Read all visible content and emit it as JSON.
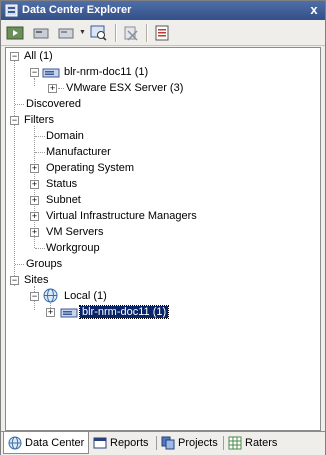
{
  "window": {
    "title": "Data Center Explorer",
    "close_label": "x"
  },
  "toolbar": {
    "buttons": [
      {
        "name": "connect-icon"
      },
      {
        "name": "add-device-icon"
      },
      {
        "name": "device-dropdown-icon"
      },
      {
        "name": "find-icon"
      },
      {
        "name": "delete-icon"
      },
      {
        "name": "properties-icon"
      }
    ]
  },
  "tree": {
    "all": "All (1)",
    "host": "blr-nrm-doc11 (1)",
    "vmware": "VMware ESX Server (3)",
    "discovered": "Discovered",
    "filters": "Filters",
    "filter_items": {
      "domain": "Domain",
      "manufacturer": "Manufacturer",
      "operating_system": "Operating System",
      "status": "Status",
      "subnet": "Subnet",
      "vim": "Virtual Infrastructure Managers",
      "vm_servers": "VM Servers",
      "workgroup": "Workgroup"
    },
    "groups": "Groups",
    "sites": "Sites",
    "local": "Local (1)",
    "local_host": "blr-nrm-doc11 (1)"
  },
  "tabs": [
    {
      "label": "Data Center"
    },
    {
      "label": "Reports"
    },
    {
      "label": "Projects"
    },
    {
      "label": "Raters"
    }
  ],
  "colors": {
    "title_bar": "#334f87",
    "selection": "#0a246a"
  }
}
